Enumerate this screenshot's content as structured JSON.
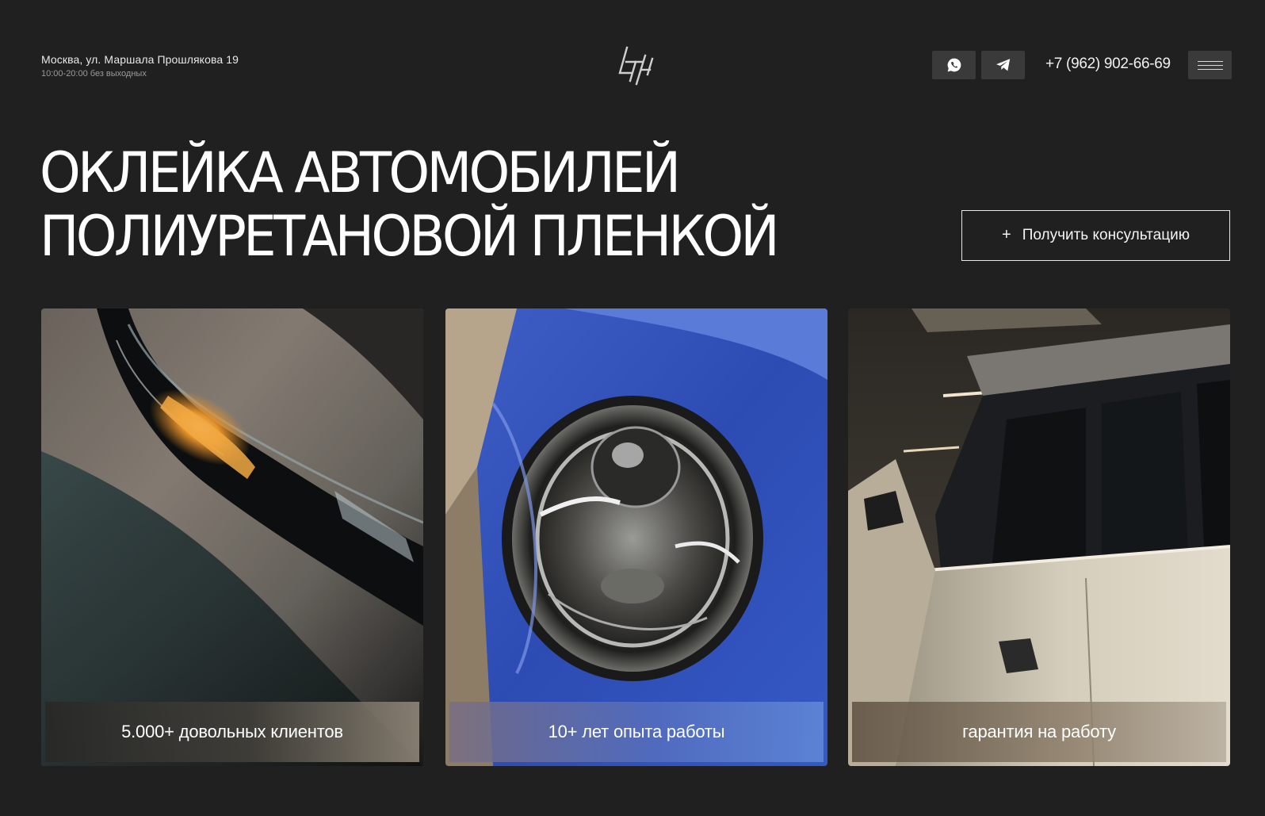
{
  "header": {
    "address": "Москва, ул. Маршала Прошлякова 19",
    "hours": "10:00-20:00 без выходных",
    "logo_icon": "lth-logo-icon",
    "whatsapp_icon": "whatsapp-icon",
    "telegram_icon": "telegram-icon",
    "phone": "+7 (962) 902-66-69",
    "menu_icon": "burger-menu-icon"
  },
  "hero": {
    "title_line_1": "ОКЛЕЙКА АВТОМОБИЛЕЙ",
    "title_line_2": "ПОЛИУРЕТАНОВОЙ ПЛЕНКОЙ",
    "cta_plus": "+",
    "cta_label": "Получить консультацию"
  },
  "cards": [
    {
      "caption": "5.000+ довольных клиентов"
    },
    {
      "caption": "10+ лет опыта работы"
    },
    {
      "caption": "гарантия на работу"
    }
  ],
  "colors": {
    "background": "#202020",
    "button_bg": "#3a3a3a",
    "text": "#ffffff"
  }
}
